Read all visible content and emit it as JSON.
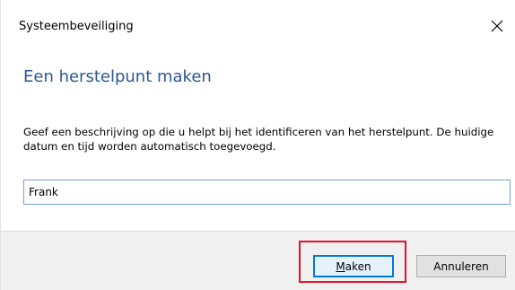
{
  "window": {
    "title": "Systeembeveiliging",
    "close_icon": "close-icon"
  },
  "main": {
    "heading": "Een herstelpunt maken",
    "description": "Geef een beschrijving op die u helpt bij het identificeren van het herstelpunt. De huidige datum en tijd worden automatisch toegevoegd.",
    "name_input_value": "Frank"
  },
  "footer": {
    "make_mnemonic": "M",
    "make_rest": "aken",
    "cancel_label": "Annuleren"
  },
  "colors": {
    "heading": "#2b5797",
    "primary_button_border": "#0078d7",
    "highlight": "#e8102e",
    "footer_background": "#f0f0f0"
  }
}
